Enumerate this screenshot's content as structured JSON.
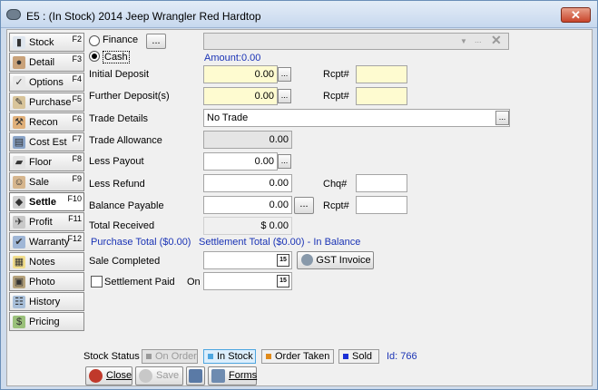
{
  "window": {
    "title": "E5 : (In Stock) 2014 Jeep Wrangler  Red Hardtop",
    "close_glyph": "✕"
  },
  "sidebar": {
    "items": [
      {
        "label": "Stock",
        "key": "F2",
        "icon": "stock-icon"
      },
      {
        "label": "Detail",
        "key": "F3",
        "icon": "detail-icon"
      },
      {
        "label": "Options",
        "key": "F4",
        "icon": "options-icon"
      },
      {
        "label": "Purchase",
        "key": "F5",
        "icon": "purchase-icon"
      },
      {
        "label": "Recon",
        "key": "F6",
        "icon": "recon-icon"
      },
      {
        "label": "Cost Est",
        "key": "F7",
        "icon": "cost-est-icon"
      },
      {
        "label": "Floor",
        "key": "F8",
        "icon": "floor-icon"
      },
      {
        "label": "Sale",
        "key": "F9",
        "icon": "sale-icon"
      },
      {
        "label": "Settle",
        "key": "F10",
        "icon": "settle-icon",
        "active": true
      },
      {
        "label": "Profit",
        "key": "F11",
        "icon": "profit-icon"
      },
      {
        "label": "Warranty",
        "key": "F12",
        "icon": "warranty-icon"
      },
      {
        "label": "Notes",
        "key": "",
        "icon": "notes-icon"
      },
      {
        "label": "Photo",
        "key": "",
        "icon": "photo-icon"
      },
      {
        "label": "History",
        "key": "",
        "icon": "history-icon"
      },
      {
        "label": "Pricing",
        "key": "",
        "icon": "pricing-icon"
      }
    ]
  },
  "form": {
    "finance_label": "Finance",
    "cash_label": "Cash",
    "finance_selected": false,
    "cash_selected": true,
    "finance_button": "...",
    "finance_company_value": "",
    "amount_text": "Amount:0.00",
    "initial_deposit_label": "Initial Deposit",
    "initial_deposit_value": "0.00",
    "further_deposit_label": "Further Deposit(s)",
    "further_deposit_value": "0.00",
    "rcpt_label": "Rcpt#",
    "rcpt1_value": "",
    "rcpt2_value": "",
    "trade_details_label": "Trade Details",
    "trade_details_value": "No Trade",
    "trade_allowance_label": "Trade Allowance",
    "trade_allowance_value": "0.00",
    "less_payout_label": "Less Payout",
    "less_payout_value": "0.00",
    "less_refund_label": "Less Refund",
    "less_refund_value": "0.00",
    "chq_label": "Chq#",
    "chq_value": "",
    "balance_payable_label": "Balance Payable",
    "balance_payable_value": "0.00",
    "rcpt3_value": "",
    "total_received_label": "Total Received",
    "total_received_value": "$ 0.00",
    "summary_purchase": "Purchase Total ($0.00)",
    "summary_settlement": "Settlement Total ($0.00) - In Balance",
    "sale_completed_label": "Sale Completed",
    "sale_completed_value": "",
    "gst_invoice_label": "GST Invoice",
    "settlement_paid_label": "Settlement Paid",
    "settlement_paid_checked": false,
    "on_label": "On",
    "settlement_paid_date": "",
    "ellipsis": "...",
    "calendar_glyph": "15"
  },
  "footer": {
    "stock_status_label": "Stock Status",
    "statuses": [
      {
        "label": "On Order",
        "color": "#9a9a9a",
        "enabled": false
      },
      {
        "label": "In Stock",
        "color": "#4da6e0",
        "selected": true
      },
      {
        "label": "Order Taken",
        "color": "#e08a1a"
      },
      {
        "label": "Sold",
        "color": "#1a2fd6"
      }
    ],
    "id_text": "Id: 766",
    "buttons": {
      "close": "Close",
      "save": "Save",
      "forms": "Forms"
    }
  },
  "colors": {
    "title_bg": "#c7d8ee",
    "input_yellow": "#fefbd0",
    "link_blue": "#1a33b5"
  }
}
